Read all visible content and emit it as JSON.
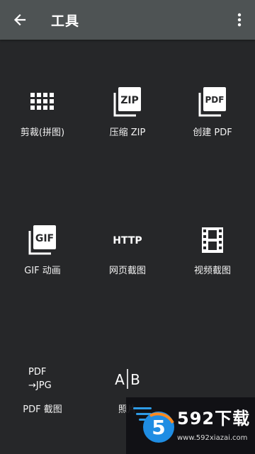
{
  "appbar": {
    "title": "工具",
    "back_icon": "arrow-left-icon",
    "more_icon": "more-vert-icon"
  },
  "tools": [
    {
      "label": "剪裁(拼图)",
      "icon": "grid-icon"
    },
    {
      "label": "压缩 ZIP",
      "icon": "zip-icon",
      "icon_text": "ZIP"
    },
    {
      "label": "创建 PDF",
      "icon": "pdf-icon",
      "icon_text": "PDF"
    },
    {
      "label": "GIF 动画",
      "icon": "gif-icon",
      "icon_text": "GIF"
    },
    {
      "label": "网页截图",
      "icon": "http-icon",
      "icon_text": "HTTP"
    },
    {
      "label": "视频截图",
      "icon": "film-icon"
    },
    {
      "label": "PDF 截图",
      "icon": "pdf-to-jpg-icon",
      "icon_text_top": "PDF",
      "icon_text_bottom": "→JPG"
    },
    {
      "label": "照片",
      "icon": "ab-compare-icon",
      "icon_text_a": "A",
      "icon_text_b": "B"
    }
  ],
  "watermark": {
    "logo_text": "5",
    "brand": "592下载",
    "url": "www.592xiazai.com"
  },
  "colors": {
    "background": "#262729",
    "appbar": "#4e5354",
    "text": "#ffffff"
  }
}
